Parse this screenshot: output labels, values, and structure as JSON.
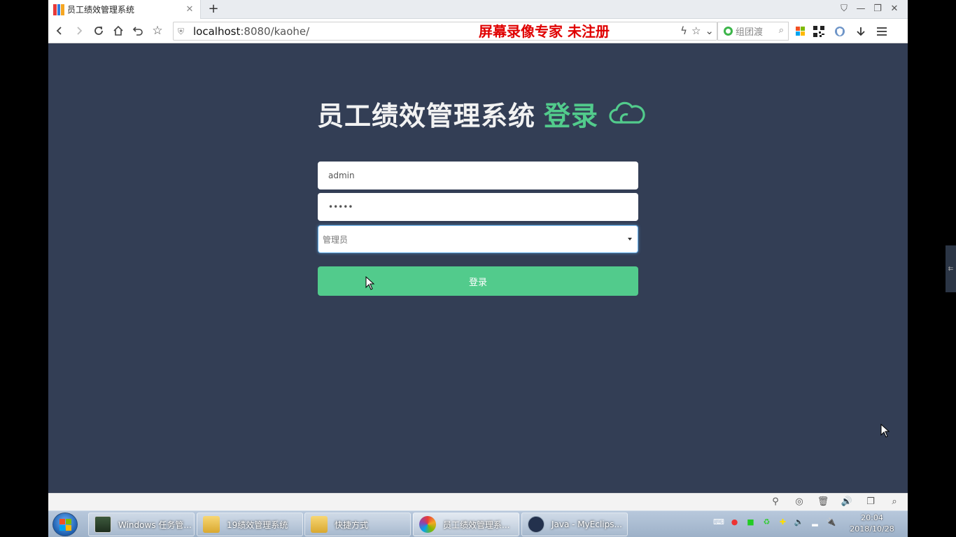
{
  "browser": {
    "tab_title": "员工绩效管理系统",
    "url_host": "localhost",
    "url_path": ":8080/kaohe/",
    "watermark": "屏幕录像专家  未注册",
    "search_placeholder": "组团渡"
  },
  "login": {
    "title": "员工绩效管理系统",
    "title_accent": "登录",
    "username_value": "admin",
    "password_value": "•••••",
    "role_selected": "管理员",
    "submit_label": "登录",
    "colors": {
      "background": "#333e55",
      "accent": "#52cb8c"
    }
  },
  "taskbar": {
    "tasks": [
      {
        "label": "Windows 任务管..."
      },
      {
        "label": "19绩效管理系统"
      },
      {
        "label": "快捷方式"
      },
      {
        "label": "员工绩效管理系..."
      },
      {
        "label": "Java - MyEclips..."
      }
    ],
    "time": "20:04",
    "date": "2018/10/28"
  }
}
